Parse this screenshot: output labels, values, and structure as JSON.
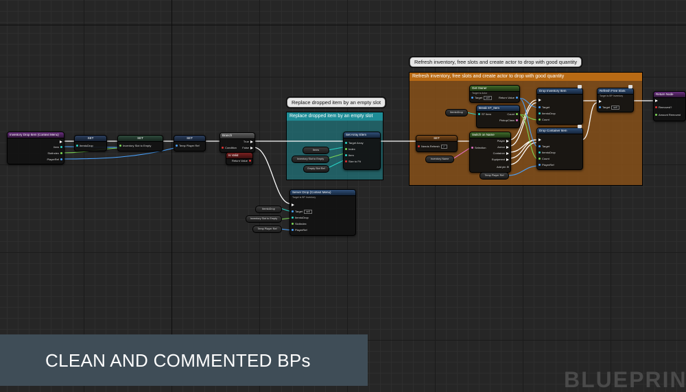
{
  "canvas": {
    "grid_color": "#262626",
    "accent_colors": {
      "exec": "#ffffff",
      "object": "#4aa3ff",
      "struct": "#29d6c8",
      "integer": "#7ed957",
      "boolean": "#e03333",
      "comment_blue": "#1e8c96",
      "comment_orange": "#8a5218"
    }
  },
  "comments": {
    "replace_slot": {
      "bubble": "Replace dropped item by an empty slot",
      "header": "Replace dropped item by an empty slot"
    },
    "refresh": {
      "bubble": "Refresh inventory, free slots and create actor to drop with good quantity",
      "header": "Refresh inventory, free slots and create actor to drop with good quantity"
    }
  },
  "nodes": {
    "event": {
      "title": "Inventory Drop Item (Context Menu)",
      "pins": [
        "Item",
        "SlotIndex",
        "PlayerRef"
      ]
    },
    "set1": {
      "title": "SET",
      "pin": "ItemtoDrop"
    },
    "set2": {
      "title": "SET",
      "pin": "Inventory Slot to Empty"
    },
    "set3": {
      "title": "SET",
      "pin": "Temp Player Ref"
    },
    "branch": {
      "title": "Branch",
      "condition": "Condition",
      "true": "True",
      "false": "False"
    },
    "sub_node": {
      "title": "Is Valid",
      "pin": "Return Value"
    },
    "set_array": {
      "title": "Set Array Elem",
      "pins": [
        "Target Array",
        "Index",
        "Item",
        "Size to Fit"
      ]
    },
    "var_items": "Items",
    "var_inv_slot": "Inventory Slot to Empty",
    "var_empty_slot": "Empty Slot Ref",
    "server_drop": {
      "title": "Server Drop (Context Menu)",
      "subtitle": "Target is BP Inventory",
      "target": "Target",
      "self": "self",
      "pins": [
        "ItemtoDrop",
        "SlotIndex",
        "PlayerRef"
      ]
    },
    "var_itemdrop": "ItemtoDrop",
    "var_inv_slot2": "Inventory Slot to Empty",
    "var_temp_player": "Temp Player Ref",
    "set_refresh": {
      "title": "SET",
      "pin": "Needs Refresh"
    },
    "var_inv_name": "Inventory Name",
    "get_owner": {
      "title": "Get Owner",
      "subtitle": "Target is Actor",
      "target": "Target",
      "self": "self",
      "ret": "Return Value"
    },
    "var_itemdrop2": "ItemtoDrop",
    "break": {
      "title": "Break ST_Item",
      "pins": [
        "ST Item",
        "Count",
        "PickupClass"
      ]
    },
    "switch": {
      "title": "Switch on Name",
      "pins": [
        "Selection",
        "Player",
        "Armor",
        "Container",
        "Equipment"
      ],
      "add_pin": "Add pin"
    },
    "var_temp_player2": "Temp Player Ref",
    "drop_item": {
      "title": "Drop Inventory Item",
      "pins": [
        "Target",
        "ItemtoDrop",
        "Count"
      ]
    },
    "drop_container": {
      "title": "Drop Container Item",
      "pins": [
        "Target",
        "ItemtoDrop",
        "Count",
        "PlayerRef"
      ]
    },
    "refresh_free": {
      "title": "Refresh Free Slots",
      "subtitle": "Target is BP Inventory",
      "target": "Target",
      "self": "self"
    },
    "return": {
      "title": "Return Node",
      "pins": [
        "Removed?",
        "Amount Removed"
      ]
    }
  },
  "caption": "CLEAN AND COMMENTED BPs",
  "watermark": "BLUEPRINT"
}
